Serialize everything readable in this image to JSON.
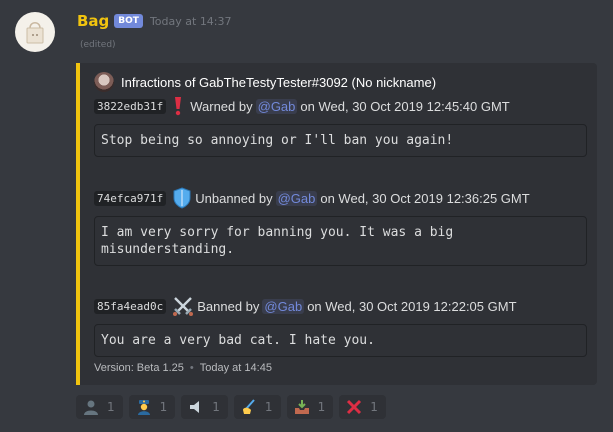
{
  "message": {
    "username": "Bag",
    "bot_tag": "BOT",
    "timestamp": "Today at 14:37",
    "edited": "(edited)",
    "username_color": "#f1c40f"
  },
  "embed": {
    "accent_color": "#f1c40f",
    "author": "Infractions of GabTheTestyTester#3092 (No nickname)",
    "fields": [
      {
        "case_id": "3822edb31f",
        "icon": "exclamation-icon",
        "action": "Warned by",
        "mention": "@Gab",
        "date": "on Wed, 30 Oct 2019 12:45:40 GMT",
        "reason": "Stop being so annoying or I'll ban you again!"
      },
      {
        "case_id": "74efca971f",
        "icon": "shield-icon",
        "action": "Unbanned by",
        "mention": "@Gab",
        "date": "on Wed, 30 Oct 2019 12:36:25 GMT",
        "reason": "I am very sorry for banning you. It was a big\nmisunderstanding."
      },
      {
        "case_id": "85fa4ead0c",
        "icon": "crossed-swords-icon",
        "action": "Banned by",
        "mention": "@Gab",
        "date": "on Wed, 30 Oct 2019 12:22:05 GMT",
        "reason": "You are a very bad cat. I hate you."
      }
    ],
    "footer": {
      "version": "Version: Beta 1.25",
      "separator": "•",
      "time": "Today at 14:45"
    }
  },
  "reactions": [
    {
      "icon": "user-silhouette-icon",
      "count": "1"
    },
    {
      "icon": "police-officer-icon",
      "count": "1"
    },
    {
      "icon": "muted-speaker-icon",
      "count": "1"
    },
    {
      "icon": "writing-hand-icon",
      "count": "1"
    },
    {
      "icon": "inbox-tray-icon",
      "count": "1"
    },
    {
      "icon": "cross-mark-icon",
      "count": "1"
    }
  ]
}
